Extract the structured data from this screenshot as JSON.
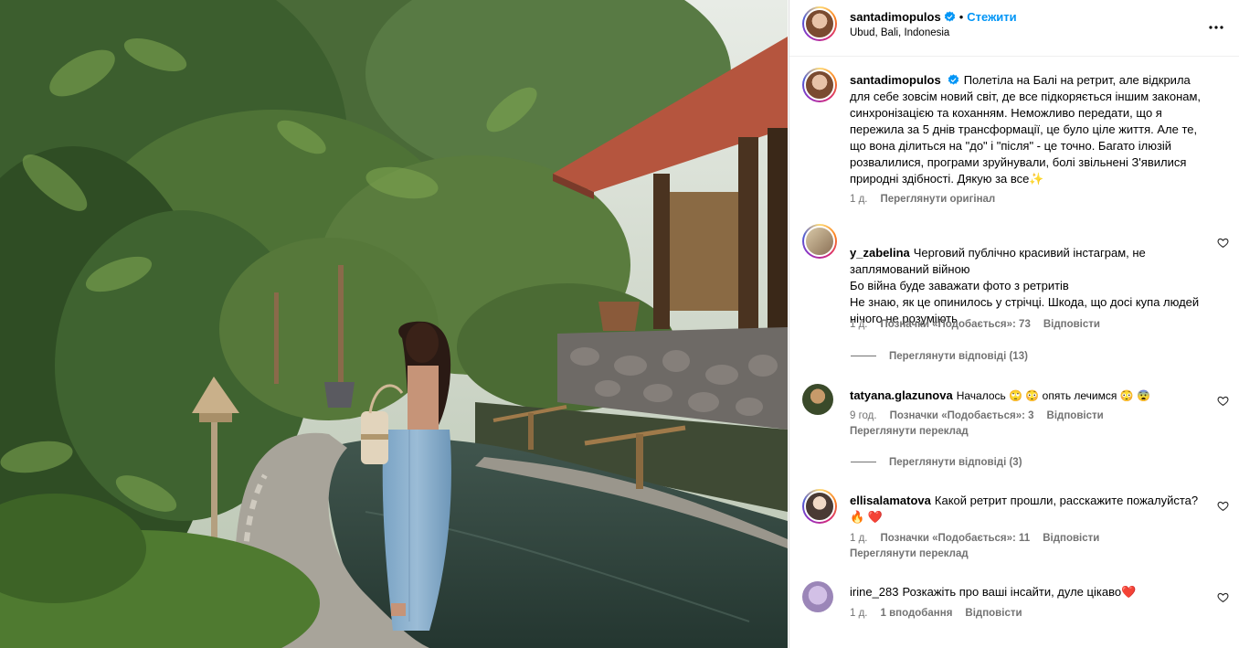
{
  "post": {
    "author": "santadimopulos",
    "follow_label": "Стежити",
    "separator": "•",
    "location": "Ubud, Bali, Indonesia",
    "more_icon": "more-horizontal-icon",
    "verified_icon": "verified-badge-icon"
  },
  "caption": {
    "username": "santadimopulos",
    "text": "Полетіла на Балі на ретрит, але відкрила для себе зовсім новий світ, де все підкоряється іншим законам, синхронізацією та коханням. Неможливо передати, що я пережила за 5 днів трансформації, це було ціле життя. Але те, що вона ділиться на \"до\" і \"після\" - це точно. Багато ілюзій розвалилися, програми зруйнували, болі звільнені З'явилися природні здібності. Дякую за все✨",
    "time": "1 д.",
    "see_original": "Переглянути оригінал"
  },
  "comments": [
    {
      "username": "y_zabelina",
      "text": "Черговий публічно красивий інстаграм, не заплямований війною\nБо війна буде заважати фото з ретритів\nНе знаю, як це опинилось у стрічці. Шкода, що досі купа людей нічого не розуміють",
      "time": "1 д.",
      "likes": "Позначки «Подобається»: 73",
      "reply": "Відповісти",
      "view_replies": "Переглянути відповіді (13)"
    },
    {
      "username": "tatyana.glazunova",
      "text": "Началось 🙄 😳 опять лечимся 😳 😨",
      "time": "9 год.",
      "likes": "Позначки «Подобається»: 3",
      "reply": "Відповісти",
      "translate": "Переглянути переклад",
      "view_replies": "Переглянути відповіді (3)"
    },
    {
      "username": "ellisalamatova",
      "text": "Какой ретрит прошли, расскажите пожалуйста? 🔥 ❤️",
      "time": "1 д.",
      "likes": "Позначки «Подобається»: 11",
      "reply": "Відповісти",
      "translate": "Переглянути переклад"
    },
    {
      "username": "irine_283",
      "text": "Розкажіть про ваші інсайти, дуле цікаво❤️",
      "time": "1 д.",
      "likes": "1 вподобання",
      "reply": "Відповісти"
    }
  ],
  "icons": {
    "heart": "heart-outline-icon"
  },
  "colors": {
    "accent": "#0095f6",
    "secondary_text": "#737373",
    "verified": "#0095f6"
  }
}
